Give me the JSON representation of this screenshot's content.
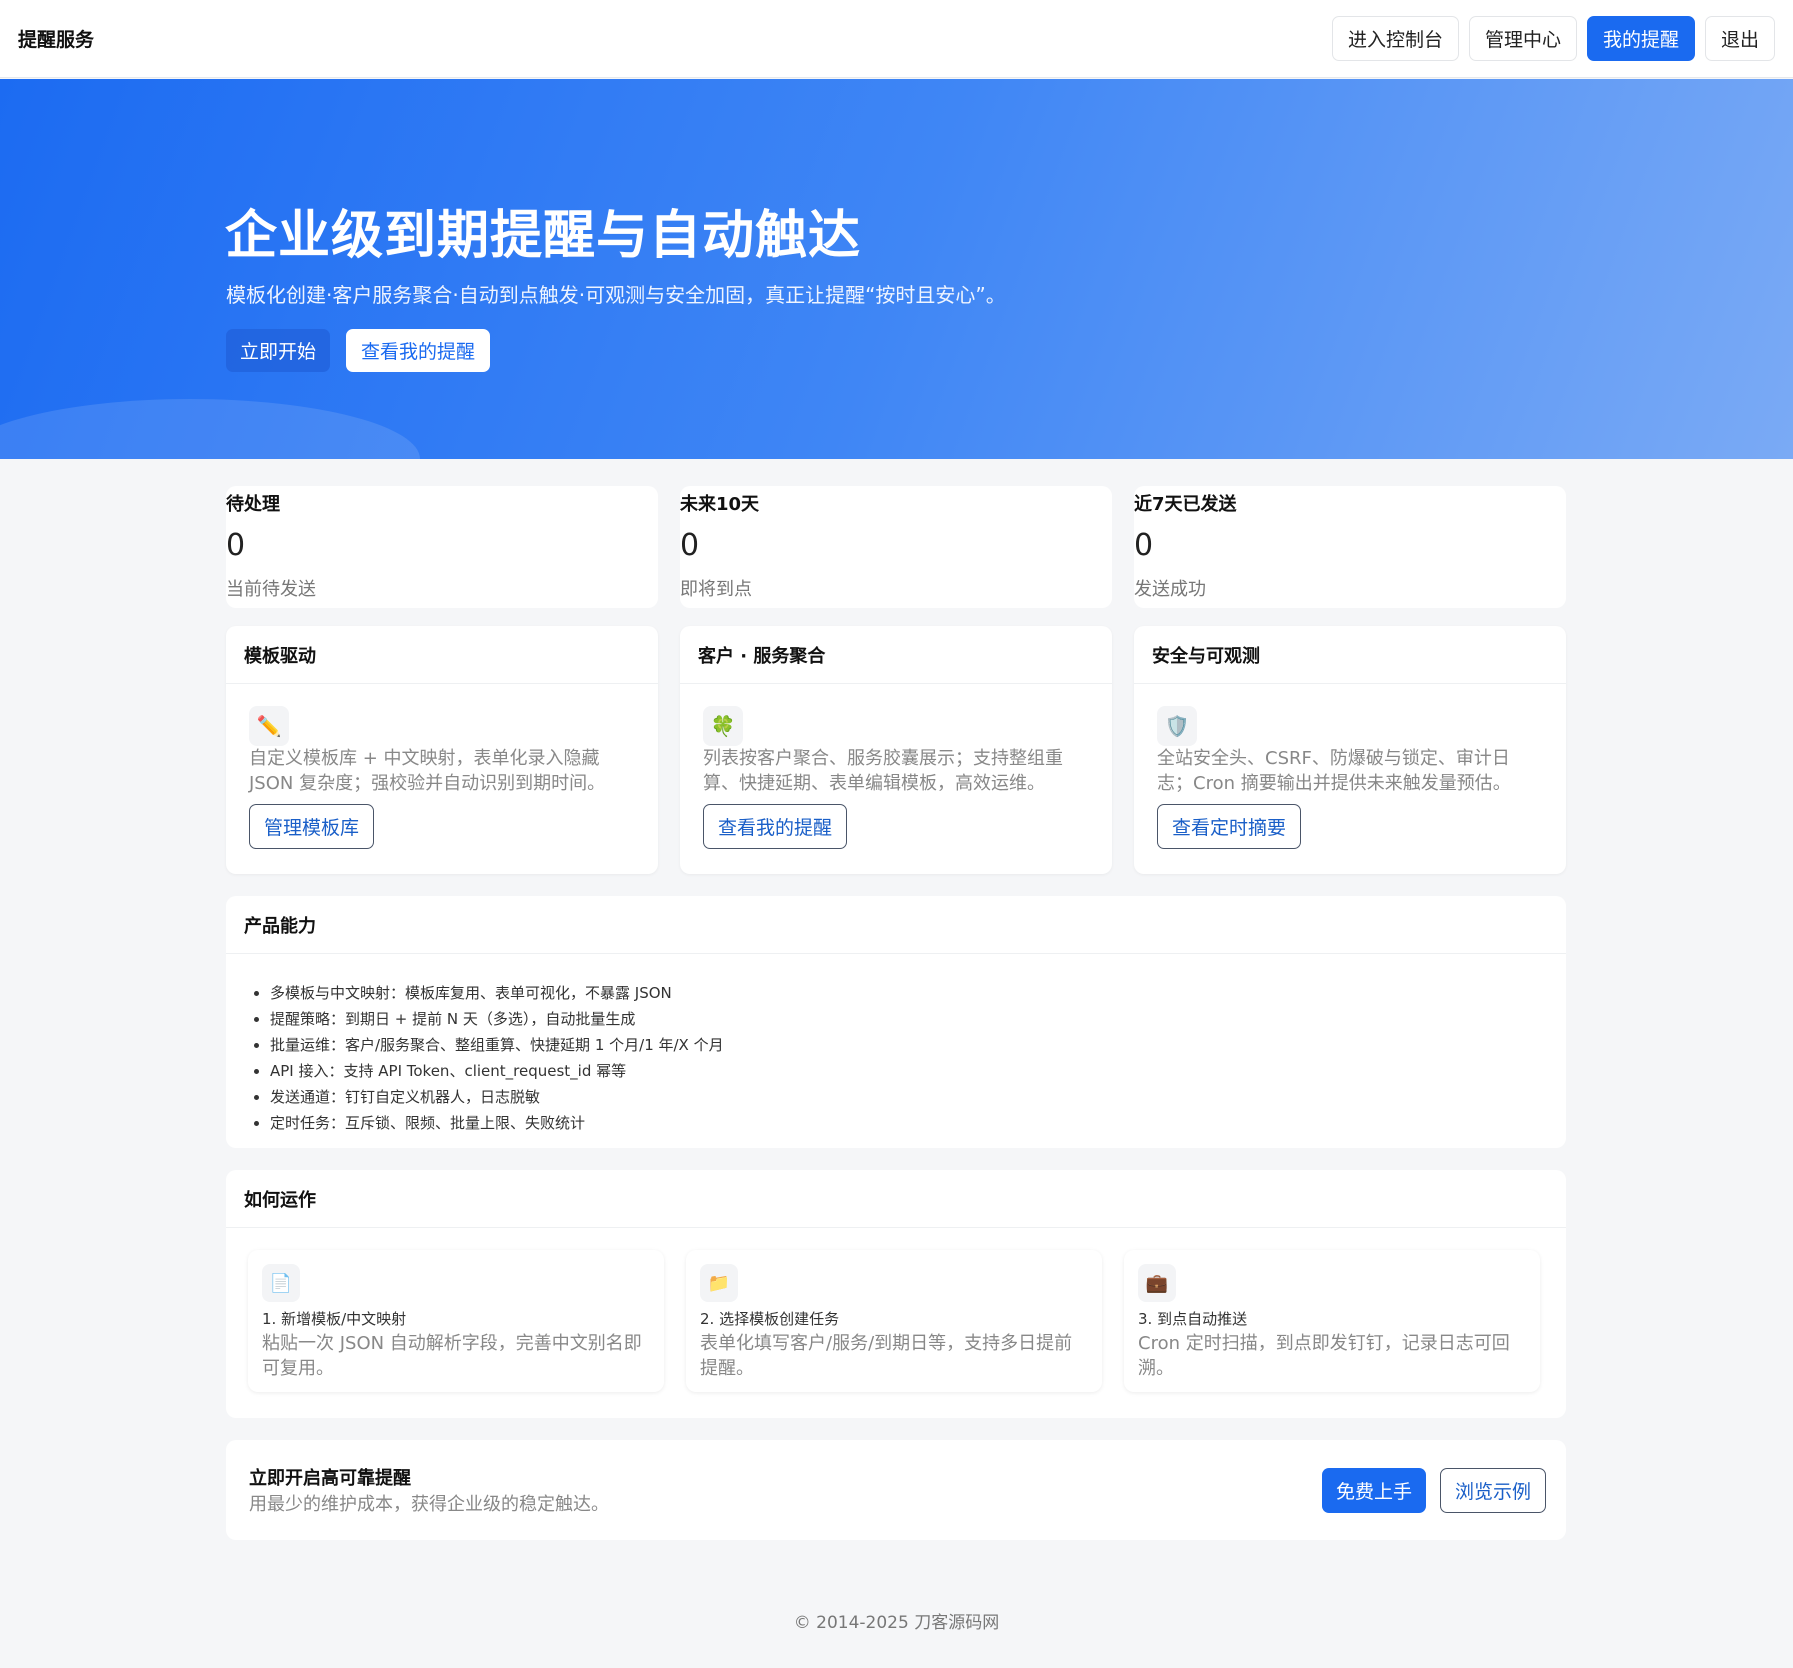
{
  "nav": {
    "brand": "提醒服务",
    "buttons": [
      "进入控制台",
      "管理中心",
      "我的提醒",
      "退出"
    ]
  },
  "hero": {
    "title": "企业级到期提醒与自动触达",
    "subtitle": "模板化创建·客户服务聚合·自动到点触发·可观测与安全加固，真正让提醒“按时且安心”。",
    "primary_cta": "立即开始",
    "secondary_cta": "查看我的提醒"
  },
  "stats": [
    {
      "title": "待处理",
      "value": "0",
      "desc": "当前待发送"
    },
    {
      "title": "未来10天",
      "value": "0",
      "desc": "即将到点"
    },
    {
      "title": "近7天已发送",
      "value": "0",
      "desc": "发送成功"
    }
  ],
  "features": [
    {
      "title": "模板驱动",
      "icon": "pencil-icon",
      "glyph": "✏️",
      "text": "自定义模板库 + 中文映射，表单化录入隐藏 JSON 复杂度；强校验并自动识别到期时间。",
      "button": "管理模板库"
    },
    {
      "title": "客户 · 服务聚合",
      "icon": "clover-icon",
      "glyph": "🍀",
      "text": "列表按客户聚合、服务胶囊展示；支持整组重算、快捷延期、表单编辑模板，高效运维。",
      "button": "查看我的提醒"
    },
    {
      "title": "安全与可观测",
      "icon": "shield-icon",
      "glyph": "🛡️",
      "text": "全站安全头、CSRF、防爆破与锁定、审计日志；Cron 摘要输出并提供未来触发量预估。",
      "button": "查看定时摘要"
    }
  ],
  "capability": {
    "title": "产品能力",
    "items": [
      "多模板与中文映射：模板库复用、表单可视化，不暴露 JSON",
      "提醒策略：到期日 + 提前 N 天（多选），自动批量生成",
      "批量运维：客户/服务聚合、整组重算、快捷延期 1 个月/1 年/X 个月",
      "API 接入：支持 API Token、client_request_id 幂等",
      "发送通道：钉钉自定义机器人，日志脱敏",
      "定时任务：互斥锁、限频、批量上限、失败统计"
    ]
  },
  "howto": {
    "title": "如何运作",
    "steps": [
      {
        "icon": "document-icon",
        "glyph": "📄",
        "title": "1. 新增模板/中文映射",
        "text": "粘贴一次 JSON 自动解析字段，完善中文别名即可复用。"
      },
      {
        "icon": "folder-icon",
        "glyph": "📁",
        "title": "2. 选择模板创建任务",
        "text": "表单化填写客户/服务/到期日等，支持多日提前提醒。"
      },
      {
        "icon": "briefcase-icon",
        "glyph": "💼",
        "title": "3. 到点自动推送",
        "text": "Cron 定时扫描，到点即发钉钉，记录日志可回溯。"
      }
    ]
  },
  "cta": {
    "title": "立即开启高可靠提醒",
    "subtitle": "用最少的维护成本，获得企业级的稳定触达。",
    "primary": "免费上手",
    "secondary": "浏览示例"
  },
  "footer": "© 2014-2025 刀客源码网",
  "colors": {
    "accent": "#1a6af0",
    "hero_start": "#1c6bf2",
    "hero_end": "#7aaaf5"
  }
}
